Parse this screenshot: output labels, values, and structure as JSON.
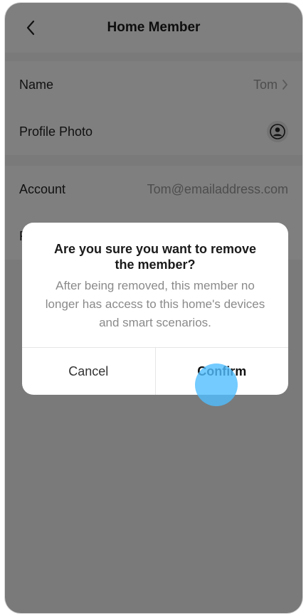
{
  "header": {
    "title": "Home Member"
  },
  "rows": {
    "name": {
      "label": "Name",
      "value": "Tom"
    },
    "photo": {
      "label": "Profile Photo"
    },
    "account": {
      "label": "Account",
      "value": "Tom@emailaddress.com"
    },
    "hidden_row_initial": "R"
  },
  "dialog": {
    "title": "Are you sure you want to remove the member?",
    "message": "After being removed, this member no longer has access to this home's devices and smart scenarios.",
    "cancel_label": "Cancel",
    "confirm_label": "Confirm"
  },
  "colors": {
    "overlay": "#000000",
    "accent_tap": "#50BEFF",
    "secondary_text": "#9B9B9B"
  }
}
